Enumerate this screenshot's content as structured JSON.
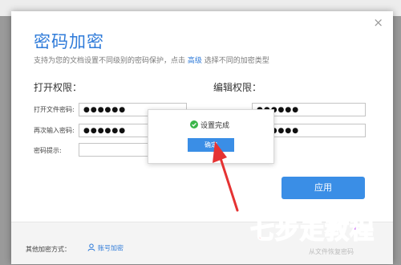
{
  "dialog": {
    "close_glyph": "×",
    "title": "密码加密",
    "subtitle_before": "支持为您的文档设置不同级别的密码保护，点击",
    "subtitle_link": "高级",
    "subtitle_after": "选择不同的加密类型"
  },
  "open_permission": {
    "heading": "打开权限：",
    "password_label": "打开文件密码:",
    "password_value": "●●●●●●",
    "confirm_label": "再次输入密码:",
    "confirm_value": "●●●●●●",
    "hint_label": "密码提示:",
    "hint_value": ""
  },
  "edit_permission": {
    "heading": "编辑权限：",
    "password_value": "●●●●●●",
    "confirm_value": "●●●●●●"
  },
  "apply_button": "应用",
  "footer": {
    "other_label": "其他加密方式：",
    "account_link": "账号加密",
    "faint_text": "从文件恢复密码"
  },
  "popup": {
    "message": "设置完成",
    "ok_button": "确定"
  },
  "watermark": [
    "七",
    "步",
    "走",
    "教",
    "程"
  ],
  "colors": {
    "accent": "#3a8ee6",
    "title": "#2f7bd9",
    "success": "#3bb54a",
    "arrow": "#e53333"
  }
}
